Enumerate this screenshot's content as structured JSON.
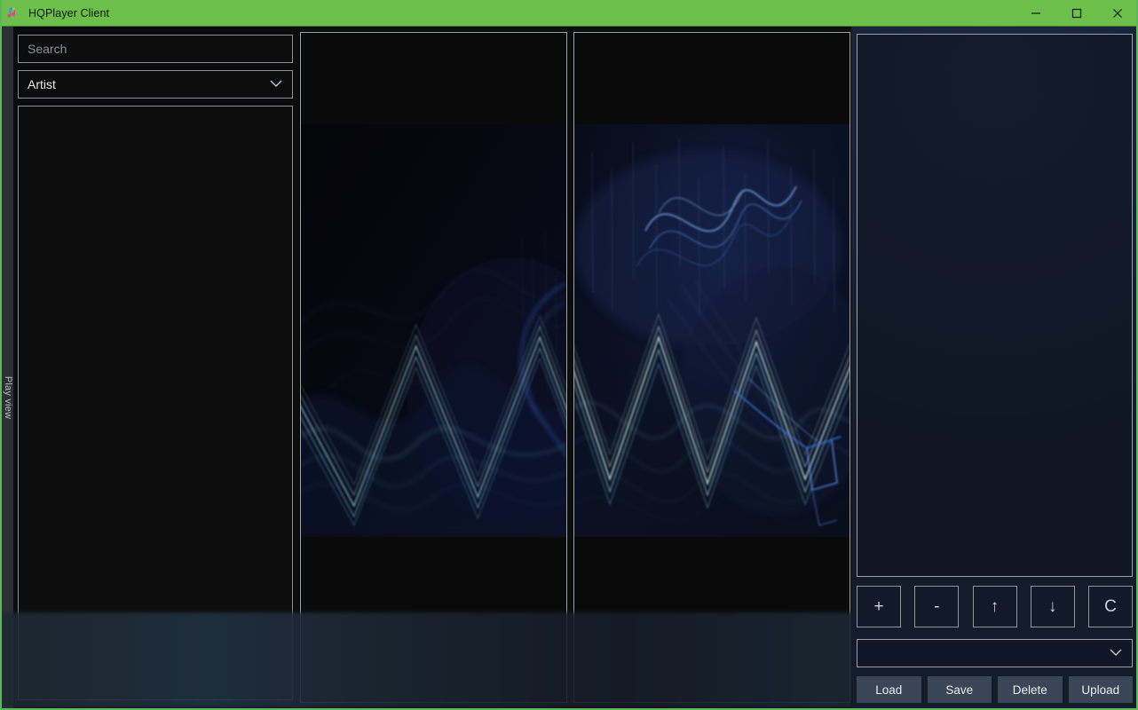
{
  "window": {
    "title": "HQPlayer Client",
    "icon": "music-note-icon",
    "accent_color": "#6cbf4b",
    "controls": {
      "minimize": "minimize-icon",
      "maximize": "maximize-icon",
      "close": "close-icon"
    }
  },
  "tabstrip": {
    "label": "Play view"
  },
  "library": {
    "search": {
      "placeholder": "Search",
      "value": ""
    },
    "browse_mode": {
      "value": "Artist",
      "chevron": "chevron-down-icon"
    },
    "list_items": []
  },
  "artwork": {
    "left_panel": "album-art-left",
    "right_panel": "album-art-right",
    "description": "abstract blue zigzag waveform artwork"
  },
  "queue": {
    "items": [],
    "controls": [
      {
        "name": "add-button",
        "label": "+"
      },
      {
        "name": "remove-button",
        "label": "-"
      },
      {
        "name": "move-up-button",
        "label": "↑"
      },
      {
        "name": "move-down-button",
        "label": "↓"
      },
      {
        "name": "clear-button",
        "label": "C"
      }
    ],
    "preset_select": {
      "value": "",
      "chevron": "chevron-down-icon"
    },
    "actions": [
      {
        "name": "load-button",
        "label": "Load"
      },
      {
        "name": "save-button",
        "label": "Save"
      },
      {
        "name": "delete-button",
        "label": "Delete"
      },
      {
        "name": "upload-button",
        "label": "Upload"
      }
    ]
  },
  "colors": {
    "titlebar": "#6cbf4b",
    "window_border": "#5cb85c",
    "panel_dark": "#0d0d0d",
    "panel_navy": "#141c2c",
    "button_slate": "#3b4558",
    "border_gray": "#9aa0a6"
  }
}
